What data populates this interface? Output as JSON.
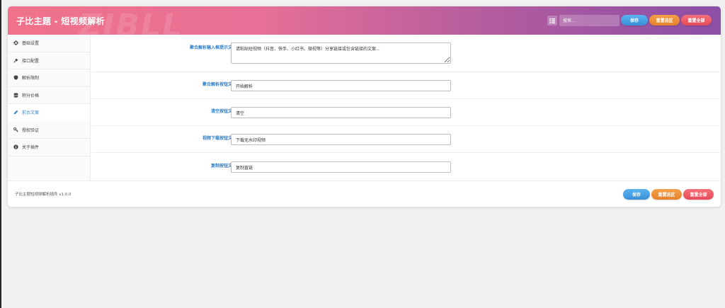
{
  "header": {
    "title": "子比主题 - 短视频解析",
    "watermark": "ZIBLL",
    "search_placeholder": "搜索...",
    "save_label": "保存",
    "reset_section_label": "重置选区",
    "reset_all_label": "重置全部"
  },
  "sidebar": {
    "items": [
      {
        "label": "基础设置",
        "icon": "gear-icon"
      },
      {
        "label": "接口配置",
        "icon": "plug-icon"
      },
      {
        "label": "解析限制",
        "icon": "shield-icon"
      },
      {
        "label": "积分价格",
        "icon": "database-icon"
      },
      {
        "label": "前台文案",
        "icon": "pencil-icon",
        "active": true
      },
      {
        "label": "授权验证",
        "icon": "key-icon"
      },
      {
        "label": "关于插件",
        "icon": "info-icon"
      }
    ]
  },
  "fields": [
    {
      "label": "聚合解析输入框提示文案",
      "value": "请粘贴短视频（抖音、快手、小红书、微视等）分享链接或包含链接的文案..."
    },
    {
      "label": "聚合解析按钮文案",
      "value": "开始解析"
    },
    {
      "label": "清空按钮文案",
      "value": "清空"
    },
    {
      "label": "视频下载按钮文案",
      "value": "下载无水印视频"
    },
    {
      "label": "复制按钮文案",
      "value": "复制直链"
    }
  ],
  "footer": {
    "version_text": "子比主题短视频解析插件 v1.0.0",
    "save_label": "保存",
    "reset_section_label": "重置选区",
    "reset_all_label": "重置全部"
  },
  "colors": {
    "accent_blue": "#2f80c9",
    "header_gradient_start": "#f07189",
    "header_gradient_end": "#8a4fa6"
  }
}
